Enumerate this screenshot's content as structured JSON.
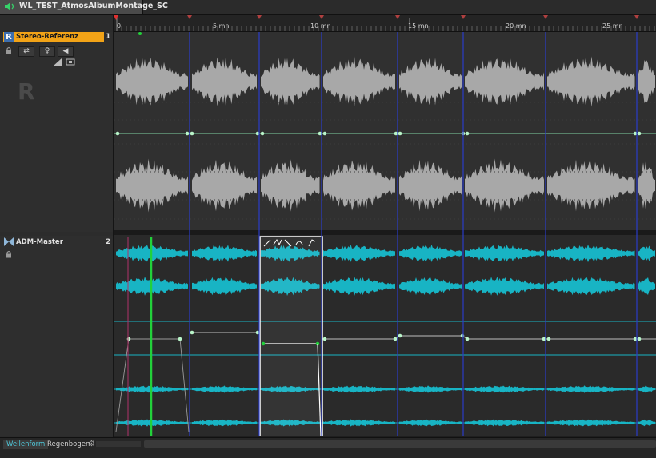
{
  "tab": {
    "title": "WL_TEST_AtmosAlbumMontage_SC",
    "icon": "speaker-icon"
  },
  "toolbar": {
    "add_label": "+",
    "search_icon": "search-icon",
    "tools": [
      "split-icon",
      "trim-icon",
      "snap-icon",
      "range-icon"
    ]
  },
  "ruler": {
    "labels": [
      "0",
      "5 mn",
      "10 mn",
      "15 mn",
      "20 mn",
      "25 mn"
    ]
  },
  "tracks": [
    {
      "letter": "R",
      "name": "Stereo-Referenz",
      "number": "1",
      "big_letter": "R",
      "buttons": [
        "⇄",
        "♀",
        "◀"
      ]
    },
    {
      "name": "ADM-Master",
      "number": "2"
    }
  ],
  "bottom": {
    "tab_waveform": "Wellenform",
    "tab_rainbow": "Regenbogen"
  },
  "colors": {
    "accent_orange": "#f2a317",
    "waveform_gray": "#a8a8a8",
    "waveform_cyan": "#18b4c4",
    "marker_blue": "#2a3cc8",
    "cursor_green": "#22d13a",
    "envelope_point": "#b9f5c9"
  }
}
